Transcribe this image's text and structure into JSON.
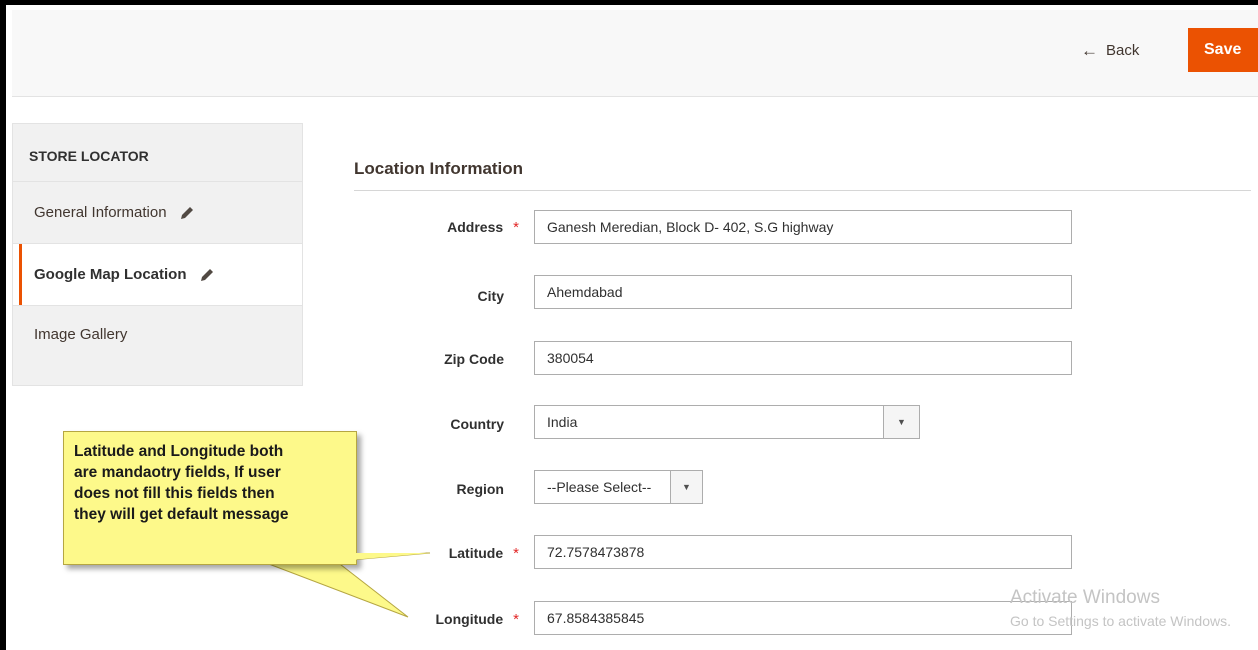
{
  "header": {
    "back_label": "Back",
    "save_label": "Save"
  },
  "sidebar": {
    "title": "STORE LOCATOR",
    "items": [
      {
        "label": "General Information",
        "icon": "pencil-icon",
        "active": false
      },
      {
        "label": "Google Map Location",
        "icon": "pencil-icon",
        "active": true
      },
      {
        "label": "Image Gallery",
        "active": false
      }
    ]
  },
  "section": {
    "title": "Location Information"
  },
  "form": {
    "address": {
      "label": "Address",
      "required": true,
      "value": "Ganesh Meredian, Block D- 402, S.G highway"
    },
    "city": {
      "label": "City",
      "required": false,
      "value": "Ahemdabad"
    },
    "zip": {
      "label": "Zip Code",
      "required": false,
      "value": "380054"
    },
    "country": {
      "label": "Country",
      "required": false,
      "value": "India"
    },
    "region": {
      "label": "Region",
      "required": false,
      "value": "--Please Select--"
    },
    "latitude": {
      "label": "Latitude",
      "required": true,
      "value": "72.7578473878"
    },
    "longitude": {
      "label": "Longitude",
      "required": true,
      "value": "67.8584385845"
    },
    "required_marker": "*"
  },
  "callout": {
    "text": "Latitude and Longitude both\nare mandaotry fields, If user\ndoes not fill this fields then\nthey will get default message"
  },
  "watermark": {
    "line1": "Activate Windows",
    "line2": "Go to Settings to activate Windows."
  },
  "colors": {
    "accent": "#eb5202",
    "required": "#e22626",
    "callout_bg": "#fdf98a"
  }
}
